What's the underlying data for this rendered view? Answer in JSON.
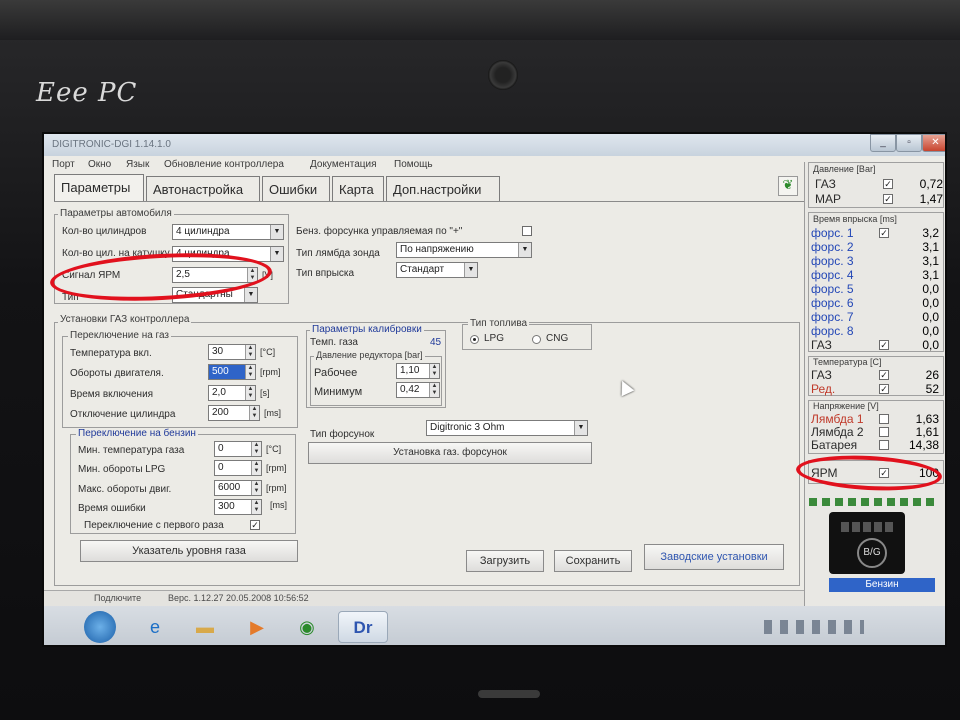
{
  "device": {
    "brand": "Eee PC"
  },
  "window": {
    "title": "DIGITRONIC-DGI 1.14.1.0"
  },
  "menu": [
    "Порт",
    "Окно",
    "Язык",
    "Обновление контроллера",
    "Документация",
    "Помощь"
  ],
  "tabs": [
    "Параметры",
    "Автонастройка",
    "Ошибки",
    "Карта",
    "Доп.настройки"
  ],
  "car_params": {
    "legend": "Параметры автомобиля",
    "cyl_label": "Кол-во цилиндров",
    "cyl_value": "4 цилиндра",
    "coil_label": "Кол-во цил. на катушку",
    "coil_value": "4 цилиндра",
    "rpm_signal_label": "Сигнал ЯРМ",
    "rpm_signal_value": "2,5",
    "rpm_signal_unit": "[V]",
    "type_label": "Тип",
    "type_value": "Стандартны",
    "petrol_injector_label": "Бенз. форсунка управляемая по \"+\"",
    "lambda_label": "Тип лямбда зонда",
    "lambda_value": "По напряжению",
    "injection_label": "Тип впрыска",
    "injection_value": "Стандарт"
  },
  "gas_setup": {
    "legend": "Установки ГАЗ контроллера",
    "to_gas": {
      "legend": "Переключение на газ",
      "rows": [
        {
          "label": "Температура вкл.",
          "value": "30",
          "unit": "[°C]"
        },
        {
          "label": "Обороты двигателя.",
          "value": "500",
          "unit": "[rpm]"
        },
        {
          "label": "Время включения",
          "value": "2,0",
          "unit": "[s]"
        },
        {
          "label": "Отключение цилиндра",
          "value": "200",
          "unit": "[ms]"
        }
      ]
    },
    "to_petrol": {
      "legend": "Переключение на бензин",
      "rows": [
        {
          "label": "Мин. температура газа",
          "value": "0",
          "unit": "[°C]"
        },
        {
          "label": "Мин. обороты LPG",
          "value": "0",
          "unit": "[rpm]"
        },
        {
          "label": "Макс. обороты двиг.",
          "value": "6000",
          "unit": "[rpm]"
        },
        {
          "label": "Время ошибки",
          "value": "300",
          "unit": "[ms]"
        }
      ],
      "first_start_label": "Переключение с первого раза"
    },
    "gas_level_button": "Указатель уровня газа"
  },
  "calibration": {
    "legend": "Параметры калибровки",
    "gas_temp_label": "Темп. газа",
    "gas_temp_value": "45",
    "reducer_legend": "Давление редуктора [bar]",
    "work_label": "Рабочее",
    "work_value": "1,10",
    "min_label": "Минимум",
    "min_value": "0,42"
  },
  "fuel_type": {
    "legend": "Тип топлива",
    "lpg": "LPG",
    "cng": "CNG"
  },
  "injectors": {
    "label": "Тип форсунок",
    "value": "Digitronic 3 Ohm",
    "button": "Установка газ. форсунок"
  },
  "buttons": {
    "load": "Загрузить",
    "save": "Сохранить",
    "factory": "Заводские установки"
  },
  "status": {
    "connected": "Подлючите",
    "version": "Верс. 1.12.27  20.05.2008  10:56:52"
  },
  "monitor": {
    "pressure": {
      "title": "Давление [Bar]",
      "rows": [
        {
          "name": "ГАЗ",
          "value": "0,72"
        },
        {
          "name": "MAP",
          "value": "1,47"
        }
      ]
    },
    "injection": {
      "title": "Время впрыска [ms]",
      "rows": [
        {
          "name": "форс. 1",
          "value": "3,2"
        },
        {
          "name": "форс. 2",
          "value": "3,1"
        },
        {
          "name": "форс. 3",
          "value": "3,1"
        },
        {
          "name": "форс. 4",
          "value": "3,1"
        },
        {
          "name": "форс. 5",
          "value": "0,0"
        },
        {
          "name": "форс. 6",
          "value": "0,0"
        },
        {
          "name": "форс. 7",
          "value": "0,0"
        },
        {
          "name": "форс. 8",
          "value": "0,0"
        },
        {
          "name": "ГАЗ",
          "value": "0,0"
        }
      ]
    },
    "temperature": {
      "title": "Температура [C]",
      "rows": [
        {
          "name": "ГАЗ",
          "value": "26"
        },
        {
          "name": "Ред.",
          "value": "52"
        }
      ]
    },
    "voltage": {
      "title": "Напряжение [V]",
      "rows": [
        {
          "name": "Лямбда 1",
          "value": "1,63"
        },
        {
          "name": "Лямбда 2",
          "value": "1,61"
        },
        {
          "name": "Батарея",
          "value": "14,38"
        }
      ]
    },
    "rpm": {
      "name": "ЯРМ",
      "value": "100"
    },
    "switch_label": "B/G",
    "fuel_state": "Бензин"
  },
  "taskbar": {
    "app_label": "Dr"
  }
}
